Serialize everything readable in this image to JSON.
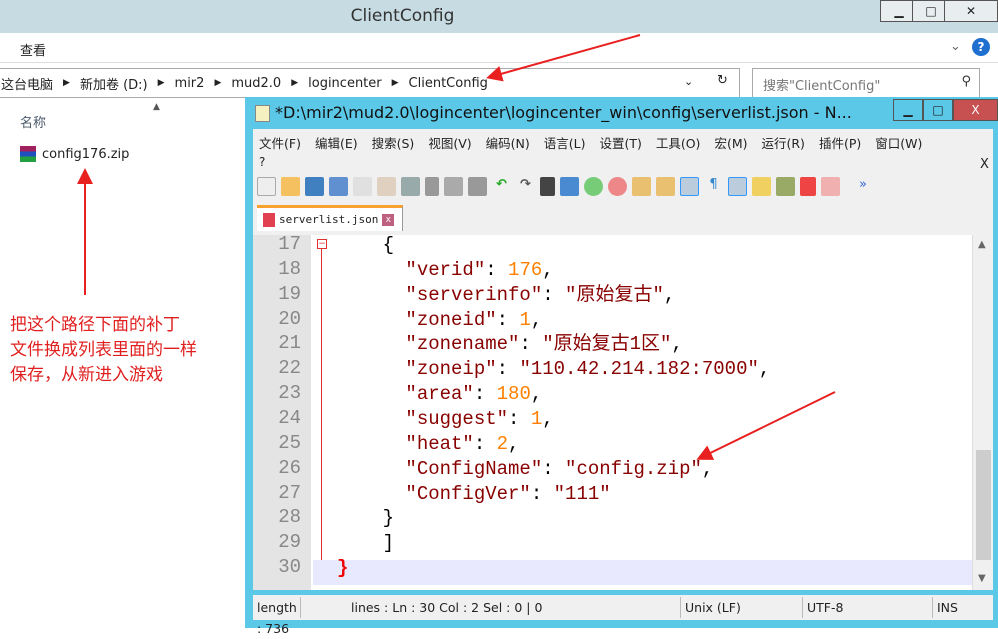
{
  "explorer": {
    "title": "ClientConfig",
    "menu_view": "查看",
    "breadcrumb": [
      "这台电脑",
      "新加卷 (D:)",
      "mir2",
      "mud2.0",
      "logincenter",
      "ClientConfig"
    ],
    "search_placeholder": "搜索\"ClientConfig\"",
    "column_name": "名称",
    "file": "config176.zip"
  },
  "annotation": [
    "把这个路径下面的补丁",
    "文件换成列表里面的一样",
    "保存，从新进入游戏"
  ],
  "npp": {
    "title": "*D:\\mir2\\mud2.0\\logincenter\\logincenter_win\\config\\serverlist.json - N...",
    "menu": [
      "文件(F)",
      "编辑(E)",
      "搜索(S)",
      "视图(V)",
      "编码(N)",
      "语言(L)",
      "设置(T)",
      "工具(O)",
      "宏(M)",
      "运行(R)",
      "插件(P)",
      "窗口(W)"
    ],
    "menu_help": "?",
    "menu_close": "X",
    "tab": "serverlist.json",
    "lines": [
      {
        "n": "17",
        "tokens": [
          {
            "t": "    {",
            "c": "p"
          }
        ]
      },
      {
        "n": "18",
        "tokens": [
          {
            "t": "      \"verid\"",
            "c": "k"
          },
          {
            "t": ": ",
            "c": "p"
          },
          {
            "t": "176",
            "c": "n"
          },
          {
            "t": ",",
            "c": "p"
          }
        ]
      },
      {
        "n": "19",
        "tokens": [
          {
            "t": "      \"serverinfo\"",
            "c": "k"
          },
          {
            "t": ": ",
            "c": "p"
          },
          {
            "t": "\"原始复古\"",
            "c": "s"
          },
          {
            "t": ",",
            "c": "p"
          }
        ]
      },
      {
        "n": "20",
        "tokens": [
          {
            "t": "      \"zoneid\"",
            "c": "k"
          },
          {
            "t": ": ",
            "c": "p"
          },
          {
            "t": "1",
            "c": "n"
          },
          {
            "t": ",",
            "c": "p"
          }
        ]
      },
      {
        "n": "21",
        "tokens": [
          {
            "t": "      \"zonename\"",
            "c": "k"
          },
          {
            "t": ": ",
            "c": "p"
          },
          {
            "t": "\"原始复古1区\"",
            "c": "s"
          },
          {
            "t": ",",
            "c": "p"
          }
        ]
      },
      {
        "n": "22",
        "tokens": [
          {
            "t": "      \"zoneip\"",
            "c": "k"
          },
          {
            "t": ": ",
            "c": "p"
          },
          {
            "t": "\"110.42.214.182:7000\"",
            "c": "s"
          },
          {
            "t": ",",
            "c": "p"
          }
        ]
      },
      {
        "n": "23",
        "tokens": [
          {
            "t": "      \"area\"",
            "c": "k"
          },
          {
            "t": ": ",
            "c": "p"
          },
          {
            "t": "180",
            "c": "n"
          },
          {
            "t": ",",
            "c": "p"
          }
        ]
      },
      {
        "n": "24",
        "tokens": [
          {
            "t": "      \"suggest\"",
            "c": "k"
          },
          {
            "t": ": ",
            "c": "p"
          },
          {
            "t": "1",
            "c": "n"
          },
          {
            "t": ",",
            "c": "p"
          }
        ]
      },
      {
        "n": "25",
        "tokens": [
          {
            "t": "      \"heat\"",
            "c": "k"
          },
          {
            "t": ": ",
            "c": "p"
          },
          {
            "t": "2",
            "c": "n"
          },
          {
            "t": ",",
            "c": "p"
          }
        ]
      },
      {
        "n": "26",
        "tokens": [
          {
            "t": "      \"ConfigName\"",
            "c": "k"
          },
          {
            "t": ": ",
            "c": "p"
          },
          {
            "t": "\"config.zip\"",
            "c": "s"
          },
          {
            "t": ",",
            "c": "p"
          }
        ]
      },
      {
        "n": "27",
        "tokens": [
          {
            "t": "      \"ConfigVer\"",
            "c": "k"
          },
          {
            "t": ": ",
            "c": "p"
          },
          {
            "t": "\"111\"",
            "c": "s"
          }
        ]
      },
      {
        "n": "28",
        "tokens": [
          {
            "t": "    }",
            "c": "p"
          }
        ]
      },
      {
        "n": "29",
        "tokens": [
          {
            "t": "    ]",
            "c": "p"
          }
        ]
      },
      {
        "n": "30",
        "tokens": [
          {
            "t": "}",
            "c": "r"
          }
        ]
      }
    ],
    "status": {
      "length": "length : 736",
      "lines": "lines : Ln : 30    Col : 2    Sel : 0 | 0",
      "eol": "Unix (LF)",
      "encoding": "UTF-8",
      "mode": "INS"
    }
  }
}
